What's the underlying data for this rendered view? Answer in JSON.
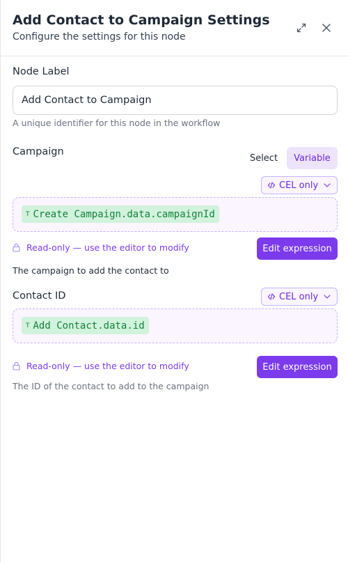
{
  "header": {
    "title": "Add Contact to Campaign Settings",
    "subtitle": "Configure the settings for this node",
    "expand_icon": "expand-icon",
    "close_icon": "close-icon"
  },
  "node_label": {
    "label": "Node Label",
    "value": "Add Contact to Campaign",
    "help": "A unique identifier for this node in the workflow"
  },
  "campaign": {
    "label": "Campaign",
    "mode_select": "Select",
    "mode_variable": "Variable",
    "active_mode": "Variable",
    "cel_label": "CEL only",
    "chip_type": "T",
    "expression": "Create Campaign.data.campaignId",
    "readonly_text": "Read-only — use the editor to modify",
    "edit_button": "Edit expression",
    "description": "The campaign to add the contact to"
  },
  "contact_id": {
    "label": "Contact ID",
    "cel_label": "CEL only",
    "chip_type": "T",
    "expression": "Add Contact.data.id",
    "readonly_text": "Read-only — use the editor to modify",
    "edit_button": "Edit expression",
    "description": "The ID of the contact to add to the campaign"
  },
  "colors": {
    "accent": "#7c3aed",
    "accent_light": "#ede4fb",
    "chip_bg": "#d1f2dc",
    "chip_text": "#15803d"
  }
}
